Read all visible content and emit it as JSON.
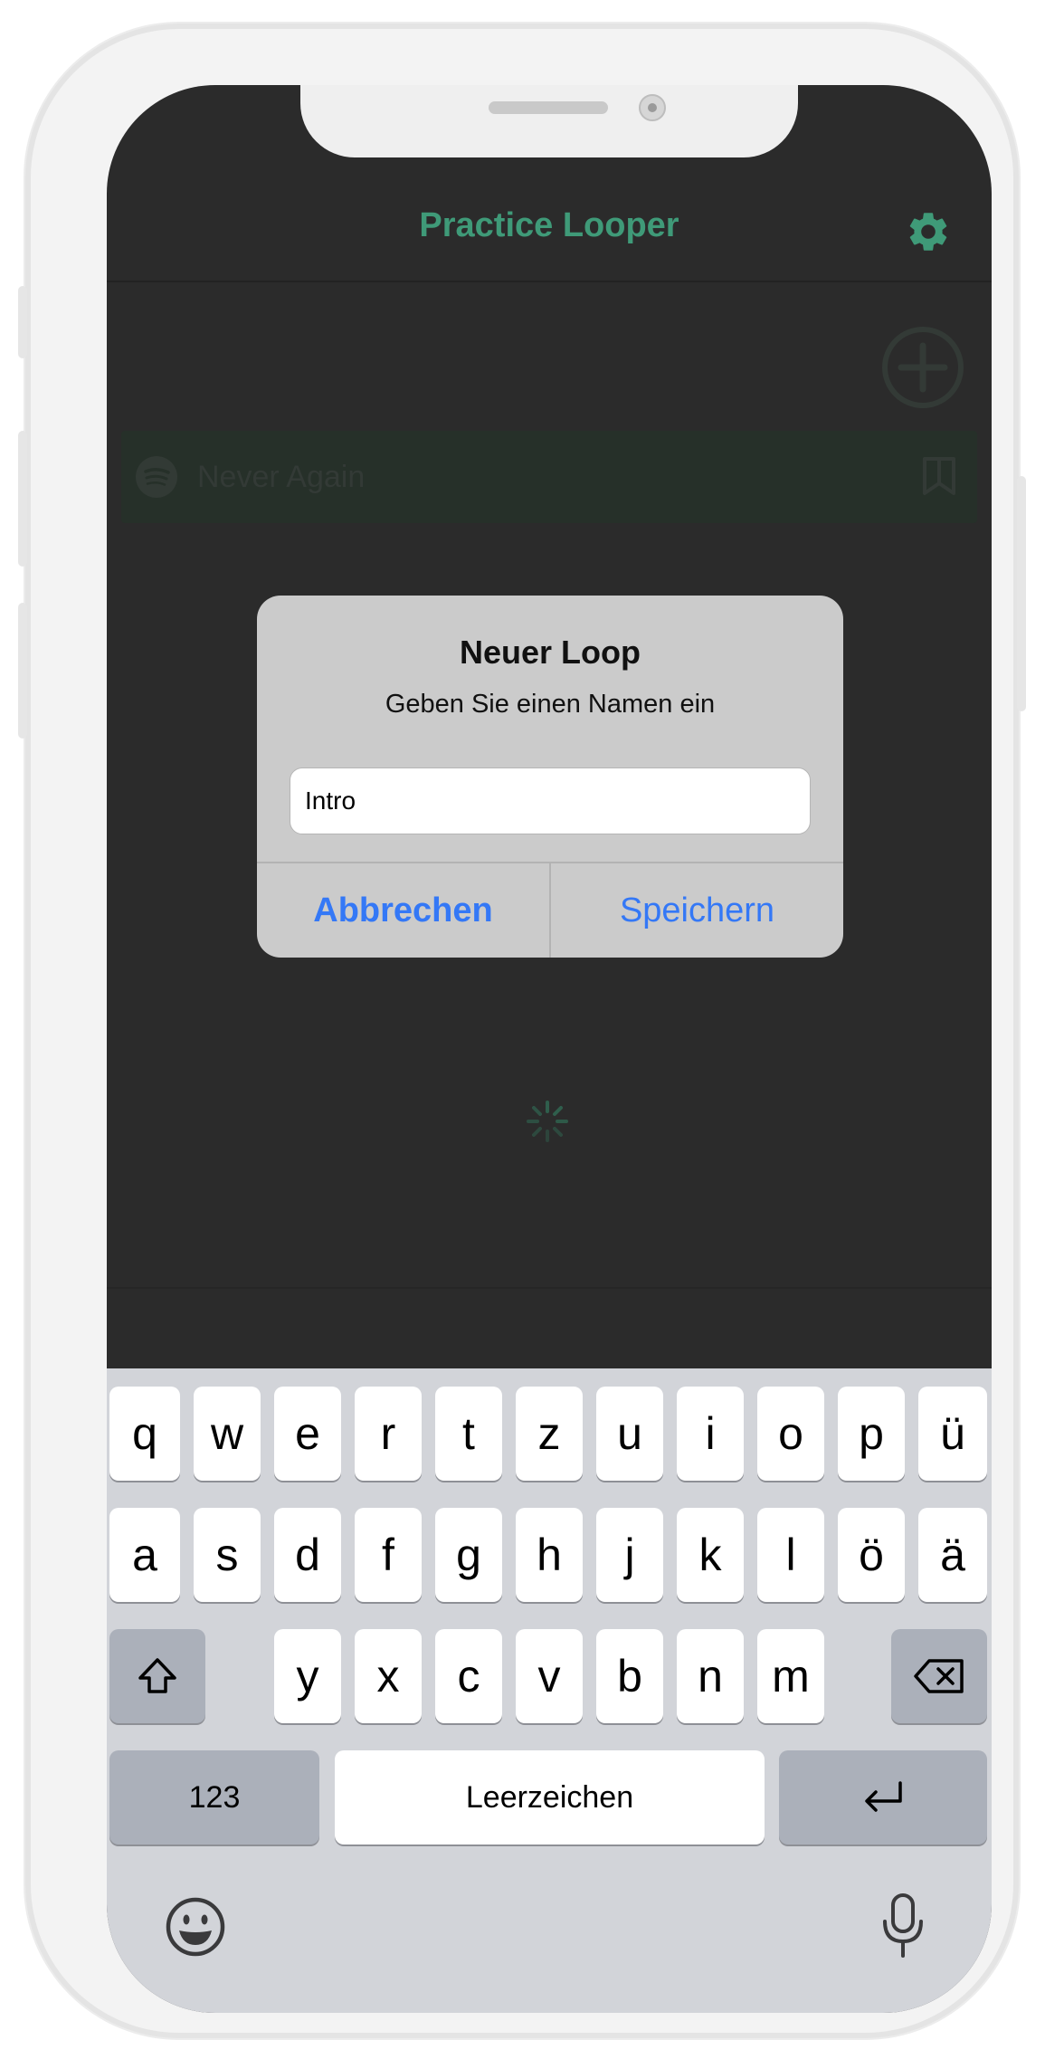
{
  "nav": {
    "title": "Practice Looper"
  },
  "song": {
    "title": "Never Again"
  },
  "alert": {
    "title": "Neuer Loop",
    "message": "Geben Sie einen Namen ein",
    "input_value": "Intro",
    "cancel_label": "Abbrechen",
    "save_label": "Speichern"
  },
  "keyboard": {
    "row1": [
      "q",
      "w",
      "e",
      "r",
      "t",
      "z",
      "u",
      "i",
      "o",
      "p",
      "ü"
    ],
    "row2": [
      "a",
      "s",
      "d",
      "f",
      "g",
      "h",
      "j",
      "k",
      "l",
      "ö",
      "ä"
    ],
    "row3": [
      "y",
      "x",
      "c",
      "v",
      "b",
      "n",
      "m"
    ],
    "numbers_label": "123",
    "space_label": "Leerzeichen"
  },
  "colors": {
    "accent": "#3f9a78",
    "link_blue": "#3478f6",
    "background": "#2b2b2b",
    "keyboard_bg": "#d2d4d9"
  },
  "icons": [
    "gear-icon",
    "add-circle-icon",
    "spotify-icon",
    "bookmark-icon",
    "spinner-icon",
    "shift-icon",
    "backspace-icon",
    "return-icon",
    "emoji-icon",
    "microphone-icon"
  ]
}
